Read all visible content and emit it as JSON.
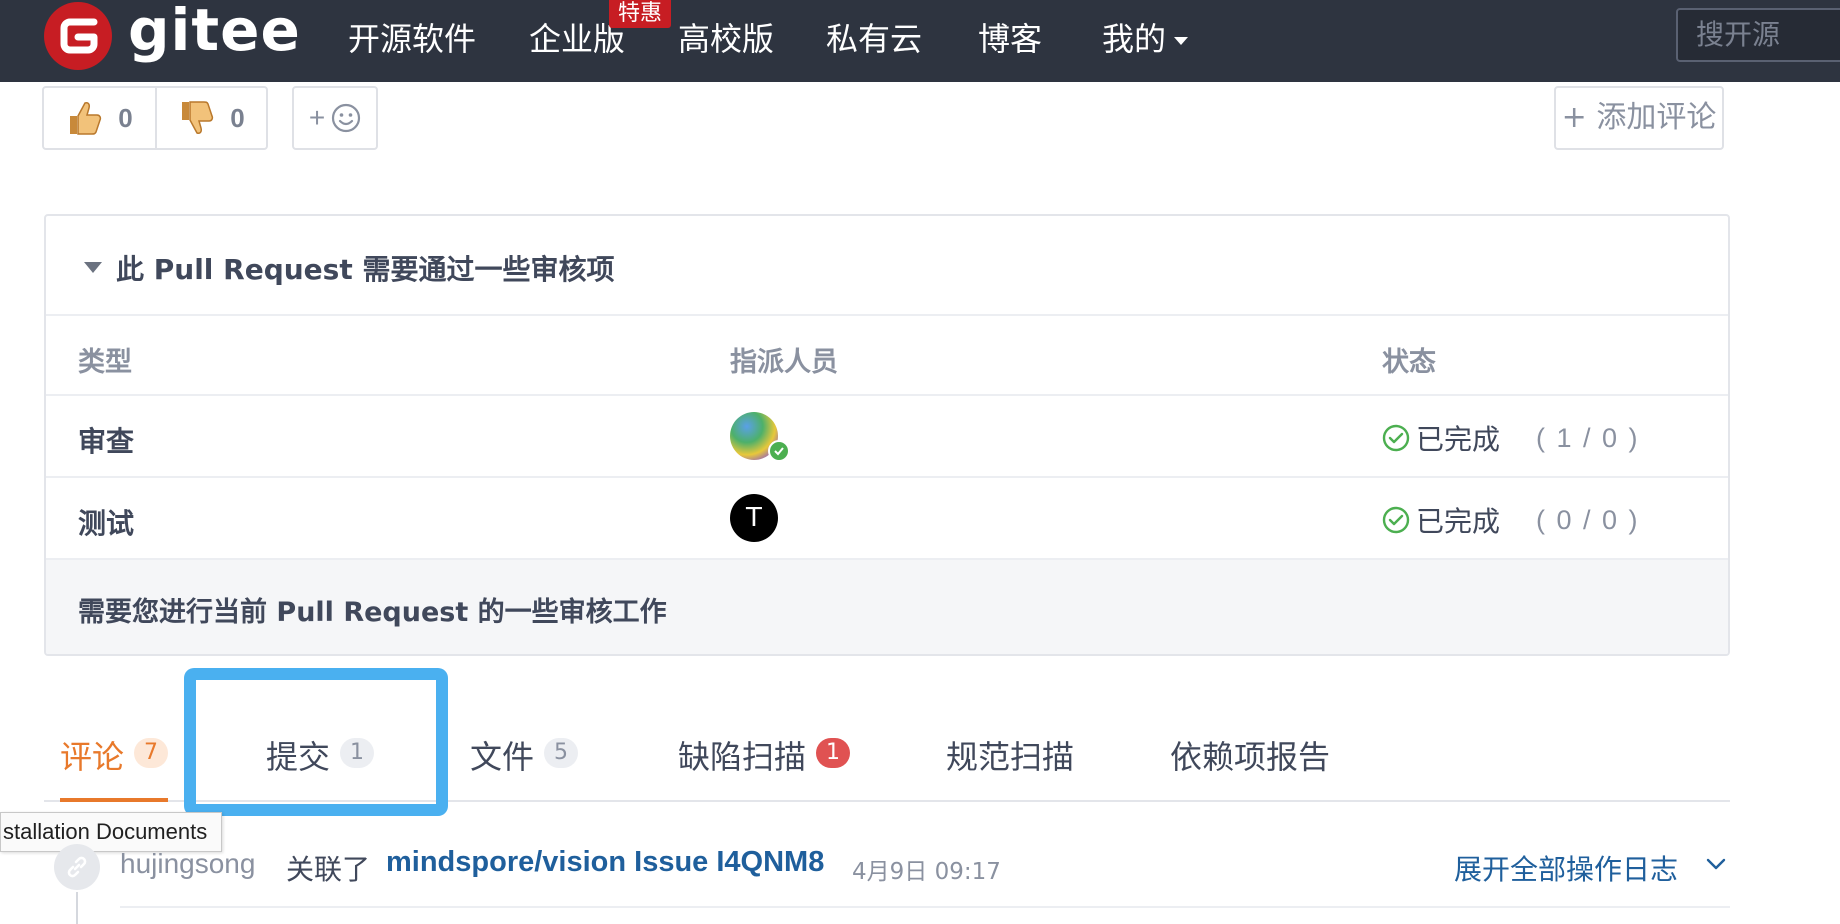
{
  "navbar": {
    "brand": "gitee",
    "items": [
      "开源软件",
      "企业版",
      "高校版",
      "私有云",
      "博客",
      "我的"
    ],
    "enterprise_badge": "特惠",
    "search_placeholder": "搜开源",
    "bg_color": "#2e3440",
    "brand_color": "#c71d23"
  },
  "reactions": {
    "thumbs_up_count": "0",
    "thumbs_down_count": "0",
    "emoji_add_label": "+",
    "add_comment_label": "+ 添加评论"
  },
  "review": {
    "title": "此 Pull Request 需要通过一些审核项",
    "columns": [
      "类型",
      "指派人员",
      "状态"
    ],
    "rows": [
      {
        "type": "审查",
        "assignee_initial": "",
        "status": "已完成",
        "count": "( 1 / 0 )"
      },
      {
        "type": "测试",
        "assignee_initial": "T",
        "status": "已完成",
        "count": "( 0 / 0 )"
      }
    ],
    "footer": "需要您进行当前 Pull Request 的一些审核工作",
    "status_color": "#4caf50"
  },
  "tabs": [
    {
      "label": "评论",
      "count": "7",
      "active": true
    },
    {
      "label": "提交",
      "count": "1",
      "active": false
    },
    {
      "label": "文件",
      "count": "5",
      "active": false
    },
    {
      "label": "缺陷扫描",
      "count": "1",
      "active": false
    },
    {
      "label": "规范扫描",
      "count": "",
      "active": false
    },
    {
      "label": "依赖项报告",
      "count": "",
      "active": false
    }
  ],
  "tooltip": "stallation Documents",
  "activity": {
    "user": "hujingsong",
    "action": "关联了",
    "target": "mindspore/vision Issue I4QNM8",
    "time": "4月9日 09:17",
    "expand_label": "展开全部操作日志"
  },
  "colors": {
    "accent_orange": "#e8792b",
    "link_blue": "#1f5f9c",
    "highlight_blue": "#4ab0f0",
    "danger_red": "#e05252"
  }
}
